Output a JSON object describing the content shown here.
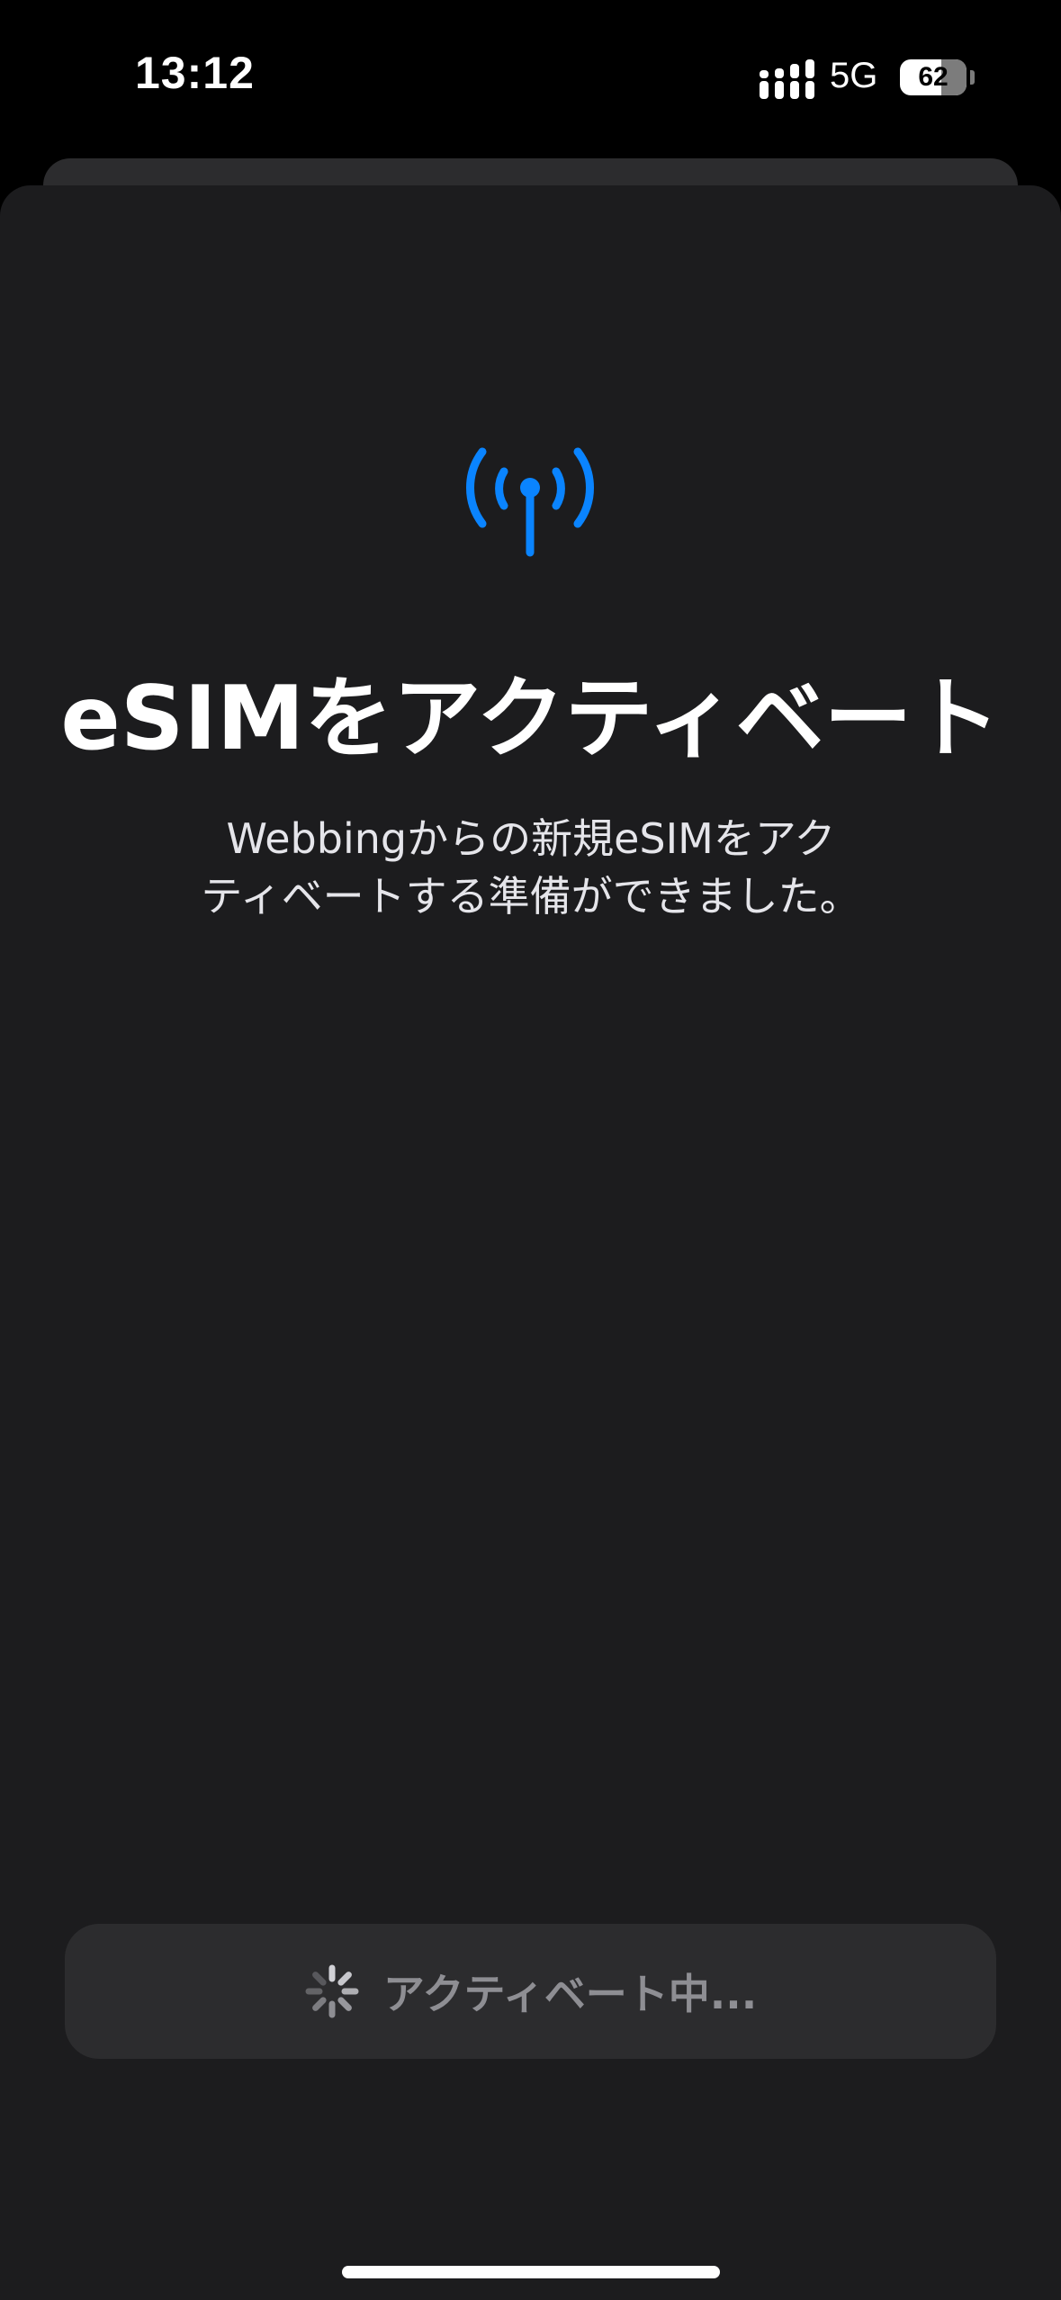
{
  "status_bar": {
    "time": "13:12",
    "network": "5G",
    "battery_level": "62",
    "battery_fraction": 0.62
  },
  "sheet": {
    "icon": "antenna-signal-icon",
    "title": "eSIMをアクティベート",
    "subtitle_line1": "Webbingからの新規eSIMをアク",
    "subtitle_line2": "ティベートする準備ができました。"
  },
  "button": {
    "icon": "spinner-icon",
    "label": "アクティベート中..."
  },
  "colors": {
    "accent": "#0a84ff",
    "sheet_background": "#1c1c1e",
    "button_background": "#2c2c2e",
    "button_text": "#8e8e93"
  }
}
